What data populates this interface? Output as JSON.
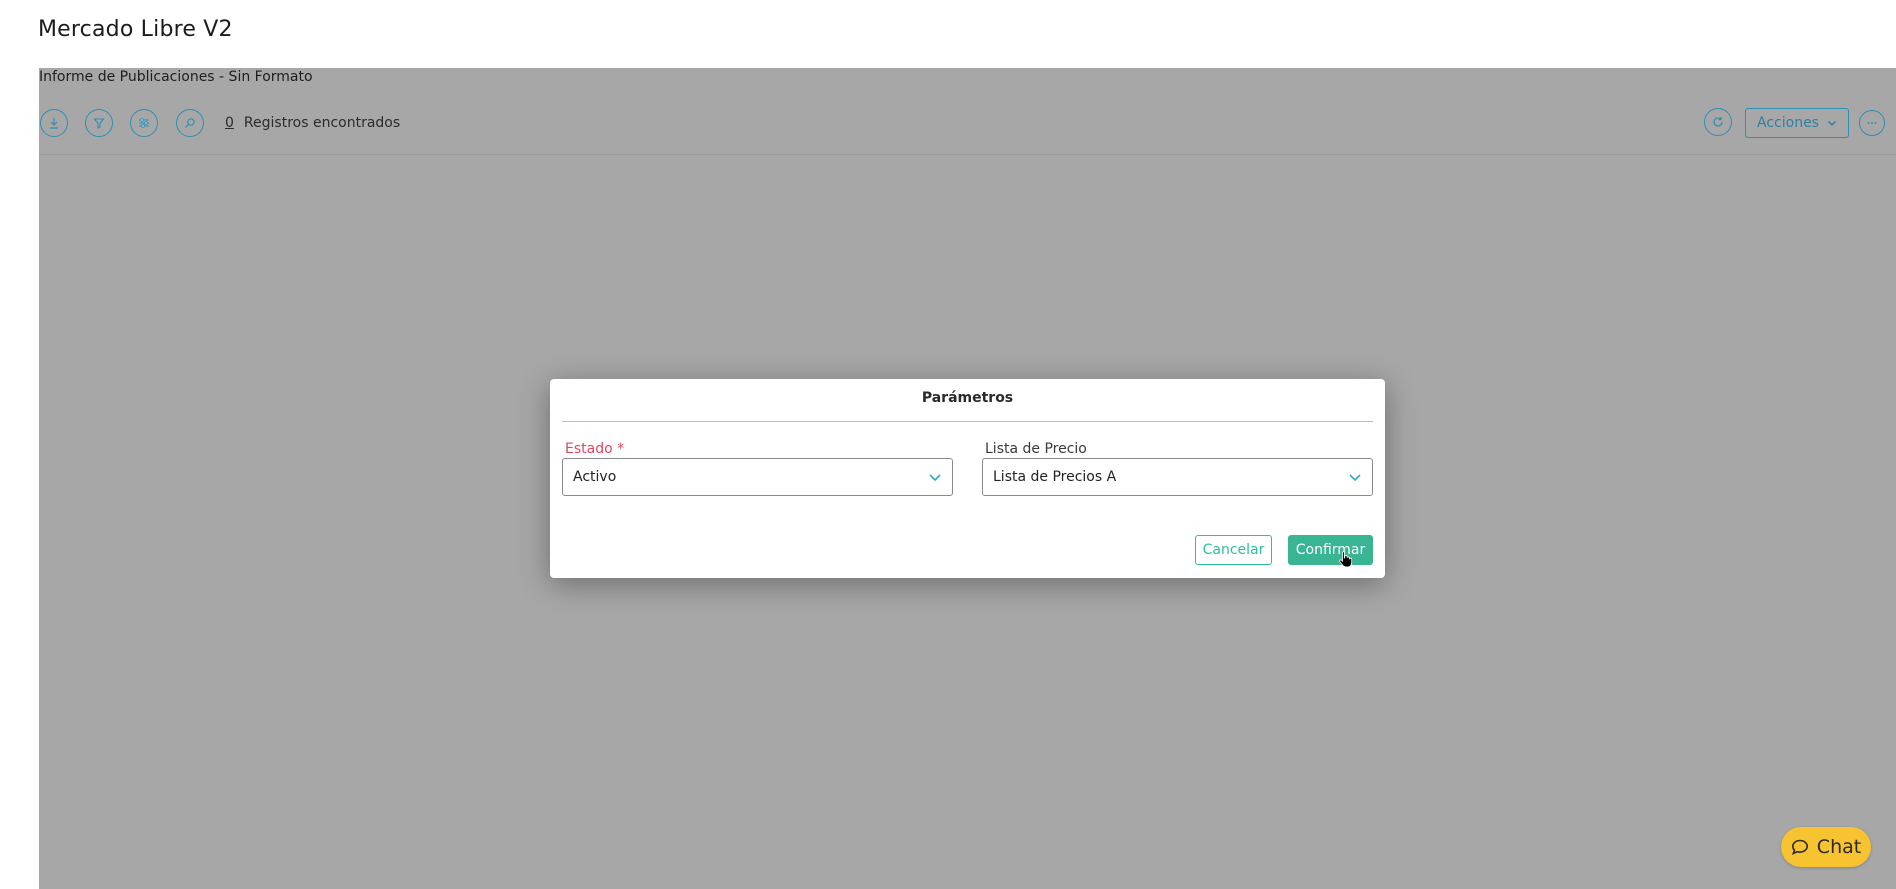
{
  "app": {
    "title": "Mercado Libre V2"
  },
  "report": {
    "title": "Informe de Publicaciones - Sin Formato",
    "record_count": "0",
    "record_count_label": "Registros encontrados",
    "toolbar": {
      "icons": [
        "download-icon",
        "filter-icon",
        "sliders-icon",
        "search-icon"
      ],
      "right_icons": [
        "refresh-icon",
        "more-icon"
      ],
      "actions_label": "Acciones"
    }
  },
  "modal": {
    "title": "Parámetros",
    "fields": [
      {
        "label": "Estado *",
        "value": "Activo",
        "required": true
      },
      {
        "label": "Lista de Precio",
        "value": "Lista de Precios A",
        "required": false
      }
    ],
    "cancel_label": "Cancelar",
    "confirm_label": "Confirmar"
  },
  "chat": {
    "label": "Chat"
  },
  "colors": {
    "accent": "#2f8fb3",
    "primary_button": "#39b594",
    "required": "#e0475f",
    "overlay": "#a7a7a7",
    "chat": "#f8c331"
  }
}
